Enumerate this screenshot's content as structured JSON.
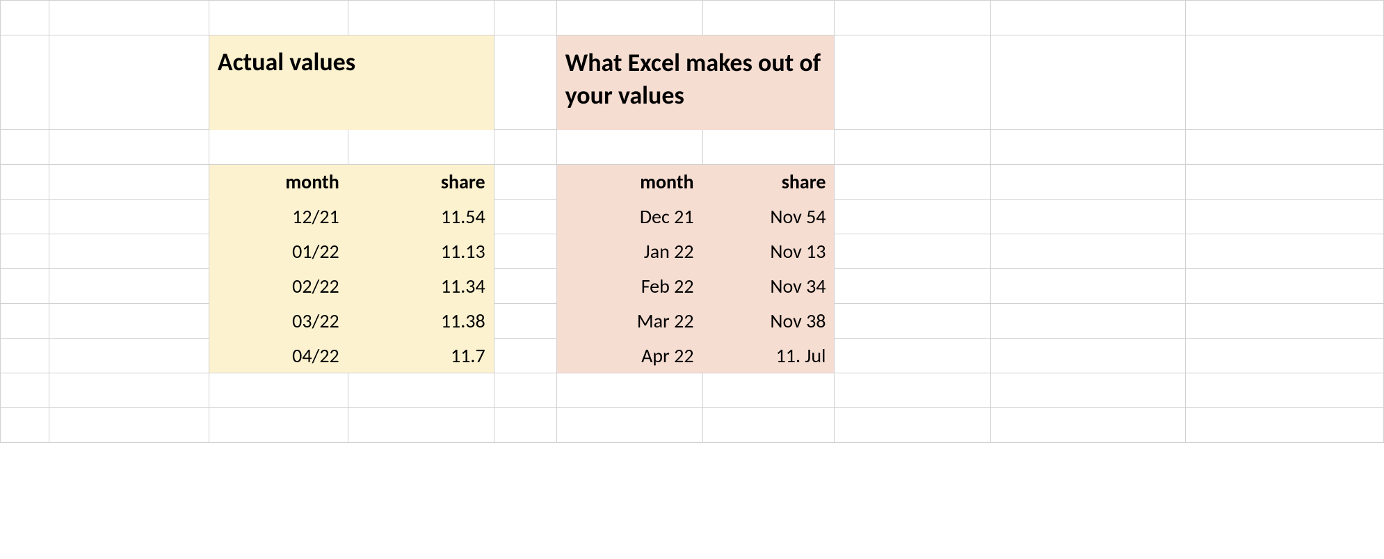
{
  "headers": {
    "actual": "Actual values",
    "excel": "What Excel makes out of your values"
  },
  "columns": {
    "month": "month",
    "share": "share"
  },
  "actual": [
    {
      "month": "12/21",
      "share": "11.54"
    },
    {
      "month": "01/22",
      "share": "11.13"
    },
    {
      "month": "02/22",
      "share": "11.34"
    },
    {
      "month": "03/22",
      "share": "11.38"
    },
    {
      "month": "04/22",
      "share": "11.7"
    }
  ],
  "excel": [
    {
      "month": "Dec 21",
      "share": "Nov 54"
    },
    {
      "month": "Jan 22",
      "share": "Nov 13"
    },
    {
      "month": "Feb 22",
      "share": "Nov 34"
    },
    {
      "month": "Mar 22",
      "share": "Nov 38"
    },
    {
      "month": "Apr 22",
      "share": "11. Jul"
    }
  ]
}
